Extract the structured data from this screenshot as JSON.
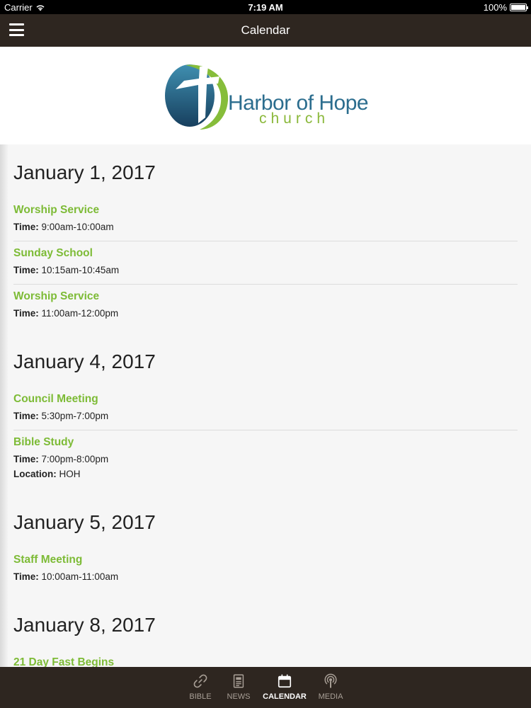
{
  "status": {
    "carrier": "Carrier",
    "time": "7:19 AM",
    "battery": "100%"
  },
  "nav": {
    "title": "Calendar"
  },
  "banner": {
    "logo_word": "Harbor of Hope",
    "logo_sub": "church"
  },
  "days": [
    {
      "date": "January 1, 2017",
      "events": [
        {
          "title": "Worship Service",
          "time_label": "Time:",
          "time": "9:00am-10:00am"
        },
        {
          "title": "Sunday School",
          "time_label": "Time:",
          "time": "10:15am-10:45am"
        },
        {
          "title": "Worship Service",
          "time_label": "Time:",
          "time": "11:00am-12:00pm"
        }
      ]
    },
    {
      "date": "January 4, 2017",
      "events": [
        {
          "title": "Council Meeting",
          "time_label": "Time:",
          "time": "5:30pm-7:00pm"
        },
        {
          "title": "Bible Study",
          "time_label": "Time:",
          "time": "7:00pm-8:00pm",
          "location_label": "Location:",
          "location": "HOH"
        }
      ]
    },
    {
      "date": "January 5, 2017",
      "events": [
        {
          "title": "Staff Meeting",
          "time_label": "Time:",
          "time": "10:00am-11:00am"
        }
      ]
    },
    {
      "date": "January 8, 2017",
      "events": [
        {
          "title": "21 Day Fast Begins"
        }
      ]
    }
  ],
  "tabs": [
    {
      "label": "BIBLE",
      "icon": "link-icon"
    },
    {
      "label": "NEWS",
      "icon": "news-icon"
    },
    {
      "label": "CALENDAR",
      "icon": "calendar-icon",
      "active": true
    },
    {
      "label": "MEDIA",
      "icon": "podcast-icon"
    }
  ],
  "colors": {
    "nav_bg": "#2e2620",
    "accent_green": "#7dbb36",
    "logo_blue": "#2b6d8e"
  }
}
